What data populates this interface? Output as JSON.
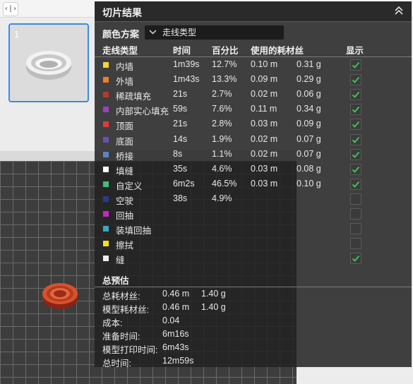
{
  "toolbar": {
    "toggle_icon": "‹|›"
  },
  "plate": {
    "number": "1"
  },
  "panel": {
    "title": "切片结果",
    "scheme_label": "颜色方案",
    "scheme_value": "走线类型"
  },
  "table": {
    "columns": [
      "走线类型",
      "时间",
      "百分比",
      "使用的耗材丝",
      "显示"
    ],
    "rows": [
      {
        "color": "#f5d33e",
        "name": "内墙",
        "time": "1m39s",
        "percent": "12.7%",
        "length": "0.10 m",
        "weight": "0.31 g",
        "shown": true
      },
      {
        "color": "#f07d2b",
        "name": "外墙",
        "time": "1m43s",
        "percent": "13.3%",
        "length": "0.09 m",
        "weight": "0.29 g",
        "shown": true
      },
      {
        "color": "#b33a2e",
        "name": "稀疏填充",
        "time": "21s",
        "percent": "2.7%",
        "length": "0.02 m",
        "weight": "0.06 g",
        "shown": true
      },
      {
        "color": "#9b3fc1",
        "name": "内部实心填充",
        "time": "59s",
        "percent": "7.6%",
        "length": "0.11 m",
        "weight": "0.34 g",
        "shown": true
      },
      {
        "color": "#e0393b",
        "name": "顶面",
        "time": "21s",
        "percent": "2.8%",
        "length": "0.03 m",
        "weight": "0.09 g",
        "shown": true
      },
      {
        "color": "#6b4fb0",
        "name": "底面",
        "time": "14s",
        "percent": "1.9%",
        "length": "0.02 m",
        "weight": "0.07 g",
        "shown": true
      },
      {
        "color": "#5b84c0",
        "name": "桥接",
        "time": "8s",
        "percent": "1.1%",
        "length": "0.02 m",
        "weight": "0.07 g",
        "shown": true
      },
      {
        "color": "#ffffff",
        "name": "填缝",
        "time": "35s",
        "percent": "4.6%",
        "length": "0.03 m",
        "weight": "0.08 g",
        "shown": true
      },
      {
        "color": "#3ec07a",
        "name": "自定义",
        "time": "6m2s",
        "percent": "46.5%",
        "length": "0.03 m",
        "weight": "0.10 g",
        "shown": true
      },
      {
        "color": "#273c91",
        "name": "空驶",
        "time": "38s",
        "percent": "4.9%",
        "length": "",
        "weight": "",
        "shown": false
      },
      {
        "color": "#c526c8",
        "name": "回抽",
        "time": "",
        "percent": "",
        "length": "",
        "weight": "",
        "shown": false
      },
      {
        "color": "#37a7c7",
        "name": "装填回抽",
        "time": "",
        "percent": "",
        "length": "",
        "weight": "",
        "shown": false
      },
      {
        "color": "#f2e21c",
        "name": "擦拭",
        "time": "",
        "percent": "",
        "length": "",
        "weight": "",
        "shown": false
      },
      {
        "color": "#eeeeee",
        "name": "缝",
        "time": "",
        "percent": "",
        "length": "",
        "weight": "",
        "shown": true
      }
    ]
  },
  "summary": {
    "title": "总预估",
    "total_filament_label": "总耗材丝:",
    "total_filament_length": "0.46 m",
    "total_filament_weight": "1.40 g",
    "model_filament_label": "模型耗材丝:",
    "model_filament_length": "0.46 m",
    "model_filament_weight": "1.40 g",
    "cost_label": "成本:",
    "cost_value": "0.04",
    "prep_time_label": "准备时间:",
    "prep_time_value": "6m16s",
    "print_time_label": "模型打印时间:",
    "print_time_value": "6m43s",
    "total_time_label": "总时间:",
    "total_time_value": "12m59s"
  },
  "colors": {
    "checkbox_on": "#3fbf55",
    "accent": "#3d8ae0"
  },
  "icons": {
    "toggle": "sidebar-toggle-icon",
    "collapse": "double-chevron-up-icon",
    "dropdown": "chevron-down-icon",
    "check": "checkmark-icon"
  }
}
